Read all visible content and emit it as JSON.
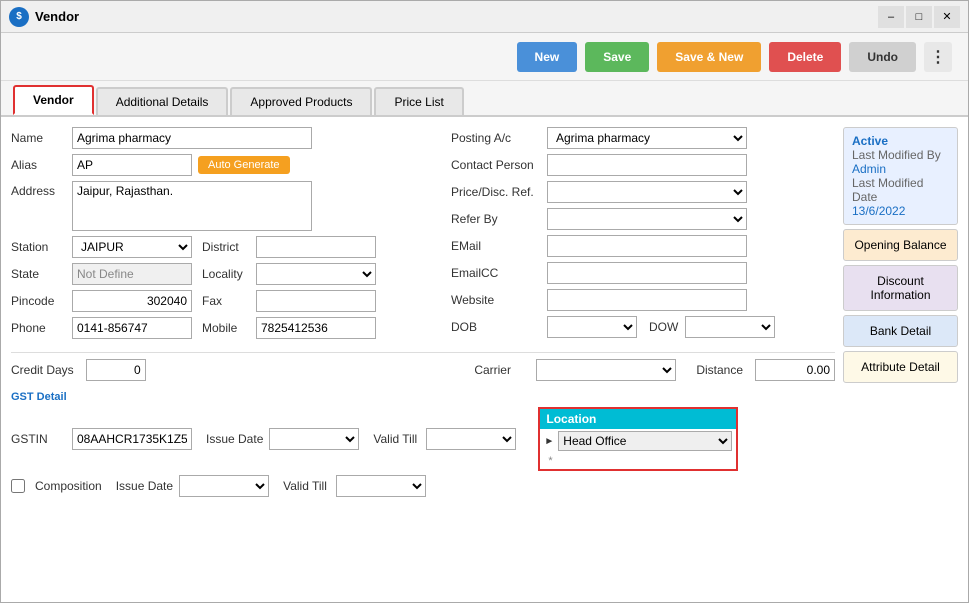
{
  "window": {
    "title": "Vendor",
    "icon": "$"
  },
  "toolbar": {
    "new_label": "New",
    "save_label": "Save",
    "save_new_label": "Save & New",
    "delete_label": "Delete",
    "undo_label": "Undo"
  },
  "tabs": [
    {
      "id": "vendor",
      "label": "Vendor",
      "active": true
    },
    {
      "id": "additional",
      "label": "Additional Details",
      "active": false
    },
    {
      "id": "approved",
      "label": "Approved Products",
      "active": false
    },
    {
      "id": "pricelist",
      "label": "Price List",
      "active": false
    }
  ],
  "form": {
    "name": "Agrima pharmacy",
    "alias": "AP",
    "address": "Jaipur, Rajasthan.",
    "station": "JAIPUR",
    "district": "",
    "state": "Not Define",
    "locality": "",
    "pincode": "302040",
    "fax": "",
    "phone": "0141-856747",
    "mobile": "7825412536",
    "posting_ac": "Agrima pharmacy",
    "contact_person": "",
    "price_disc_ref": "",
    "refer_by": "",
    "email": "",
    "emailcc": "",
    "website": "",
    "dob": "",
    "dow": "",
    "credit_days": "0",
    "carrier": "",
    "distance": "0.00",
    "gstin": "08AAHCR1735K1Z5",
    "issue_date1": "",
    "valid_till1": "",
    "issue_date2": "",
    "valid_till2": ""
  },
  "status": {
    "active": "Active",
    "last_modified_by_label": "Last Modified By",
    "admin": "Admin",
    "last_modified_date_label": "Last Modified Date",
    "date": "13/6/2022"
  },
  "side_buttons": [
    {
      "id": "opening_balance",
      "label": "Opening Balance",
      "style": "orange"
    },
    {
      "id": "discount_info",
      "label": "Discount Information",
      "style": "purple"
    },
    {
      "id": "bank_detail",
      "label": "Bank Detail",
      "style": "blue-light"
    },
    {
      "id": "attribute_detail",
      "label": "Attribute Detail",
      "style": "yellow-light"
    }
  ],
  "location": {
    "header": "Location",
    "value": "Head Office",
    "options": [
      "Head Office"
    ]
  },
  "labels": {
    "name": "Name",
    "alias": "Alias",
    "address": "Address",
    "station": "Station",
    "district": "District",
    "state": "State",
    "locality": "Locality",
    "pincode": "Pincode",
    "fax": "Fax",
    "phone": "Phone",
    "mobile": "Mobile",
    "posting_ac": "Posting A/c",
    "contact_person": "Contact Person",
    "price_disc_ref": "Price/Disc. Ref.",
    "refer_by": "Refer By",
    "email": "EMail",
    "emailcc": "EmailCC",
    "website": "Website",
    "dob": "DOB",
    "dow": "DOW",
    "credit_days": "Credit Days",
    "carrier": "Carrier",
    "distance": "Distance",
    "gst_detail": "GST Detail",
    "gstin": "GSTIN",
    "issue_date": "Issue Date",
    "valid_till": "Valid Till",
    "composition": "Composition",
    "auto_generate": "Auto Generate"
  }
}
